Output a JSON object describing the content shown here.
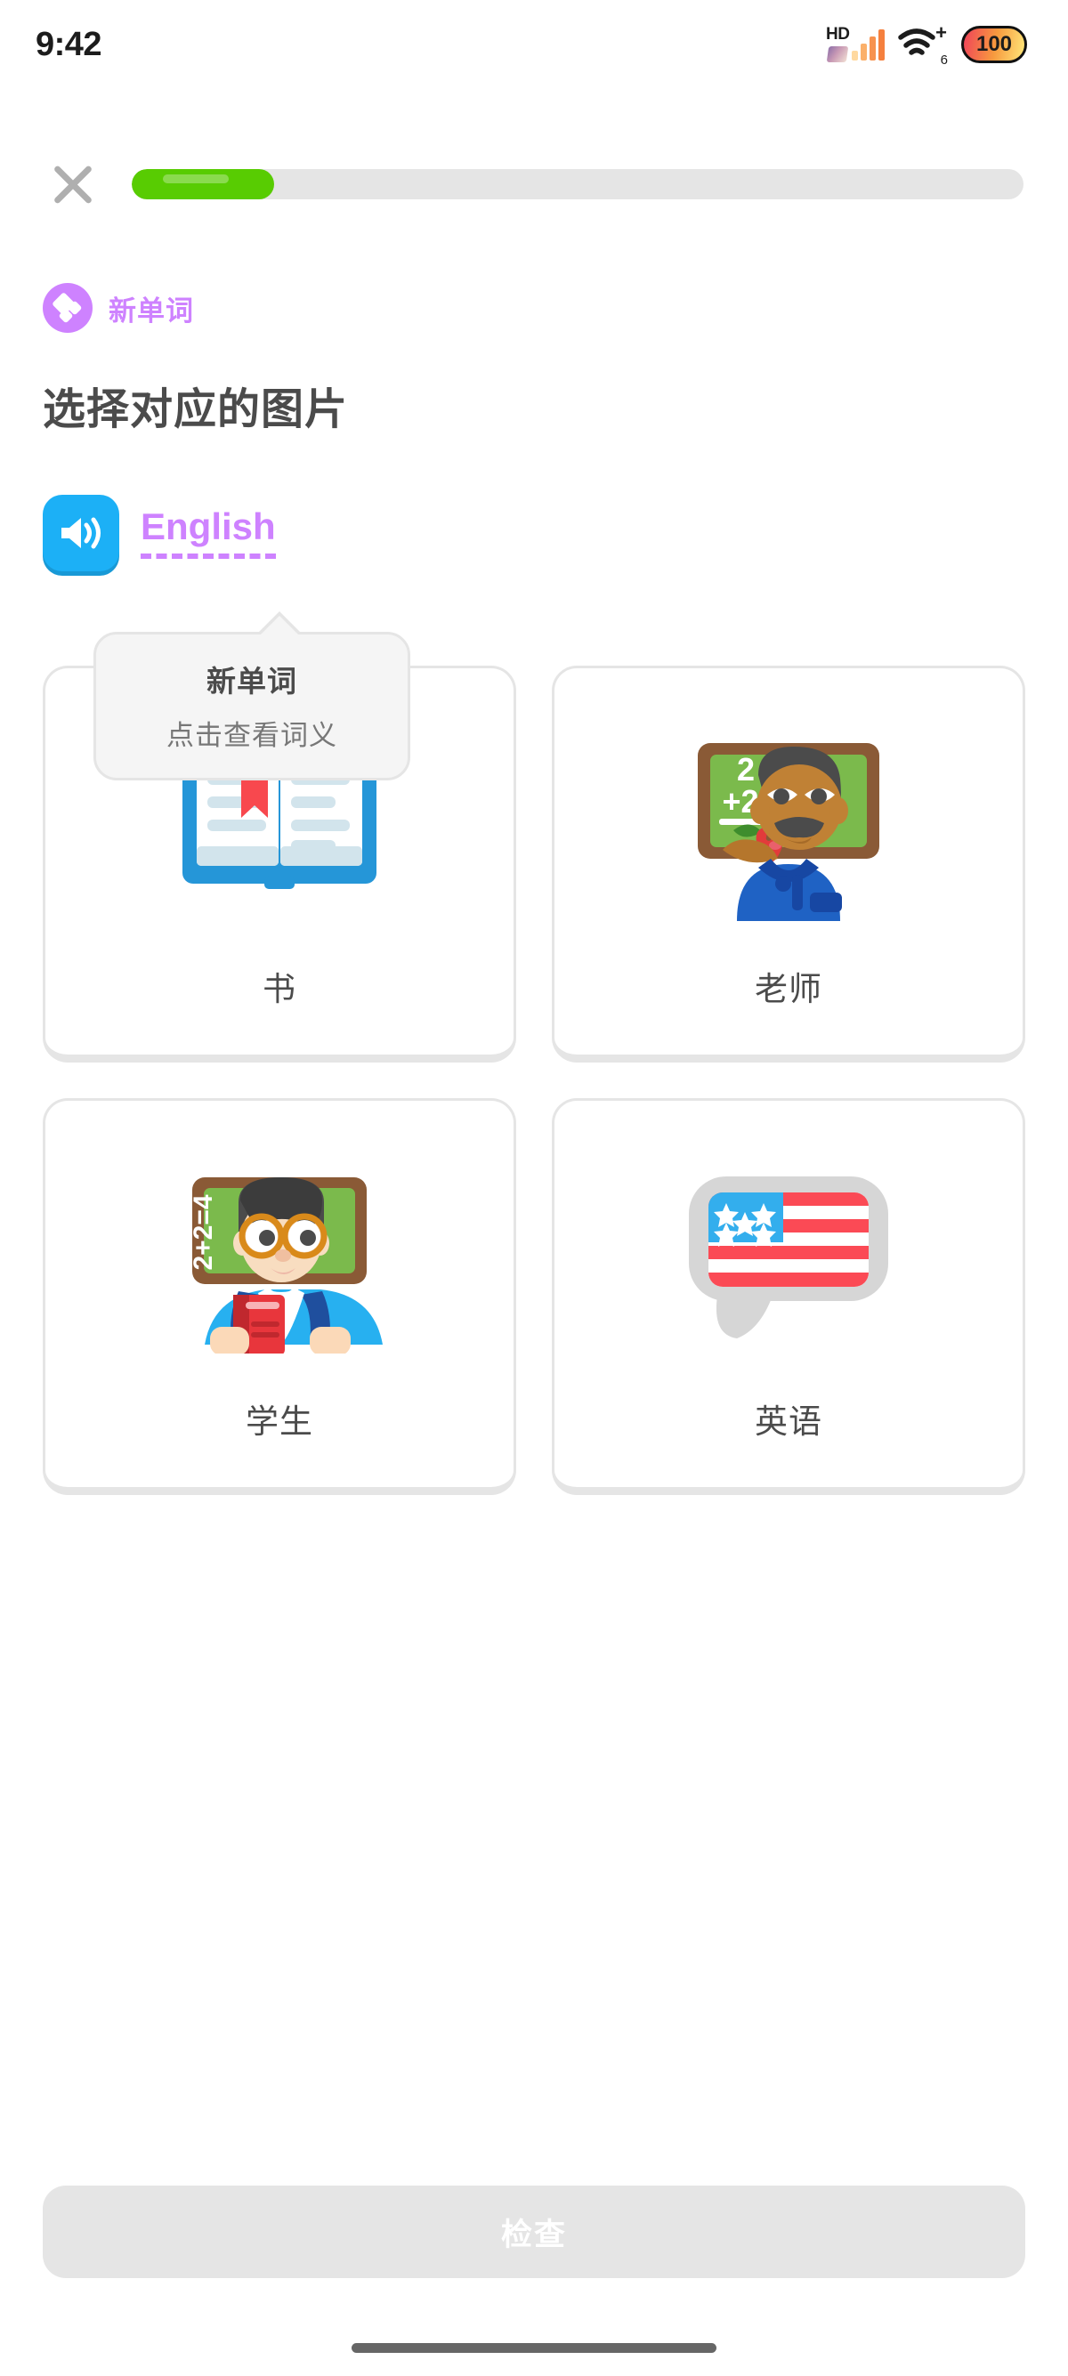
{
  "status_bar": {
    "time": "9:42",
    "hd_label": "HD",
    "wifi_plus": "+",
    "wifi_gen": "6",
    "battery_level": "100",
    "icons": [
      "sim-card-icon",
      "signal-bars-icon",
      "wifi-icon",
      "battery-icon"
    ]
  },
  "header": {
    "close_icon": "close-icon",
    "progress_percent": 16
  },
  "lesson": {
    "chip_label": "新单词",
    "chip_icon": "new-word-diamond-icon",
    "prompt_title": "选择对应的图片",
    "speaker_icon": "speaker-icon",
    "target_word": "English"
  },
  "tooltip": {
    "title": "新单词",
    "subtitle": "点击查看词义"
  },
  "choices": [
    {
      "label": "书",
      "art": "open-book-icon"
    },
    {
      "label": "老师",
      "art": "teacher-icon"
    },
    {
      "label": "学生",
      "art": "student-icon"
    },
    {
      "label": "英语",
      "art": "usa-flag-speech-bubble-icon"
    }
  ],
  "footer": {
    "check_label": "检查",
    "check_enabled": false
  },
  "colors": {
    "brand_green": "#58cc02",
    "brand_blue": "#1cb0f6",
    "accent_purple": "#ce82ff",
    "text_dark": "#4b4b4b",
    "border_gray": "#e5e5e5",
    "disabled_gray": "#e5e5e5"
  }
}
